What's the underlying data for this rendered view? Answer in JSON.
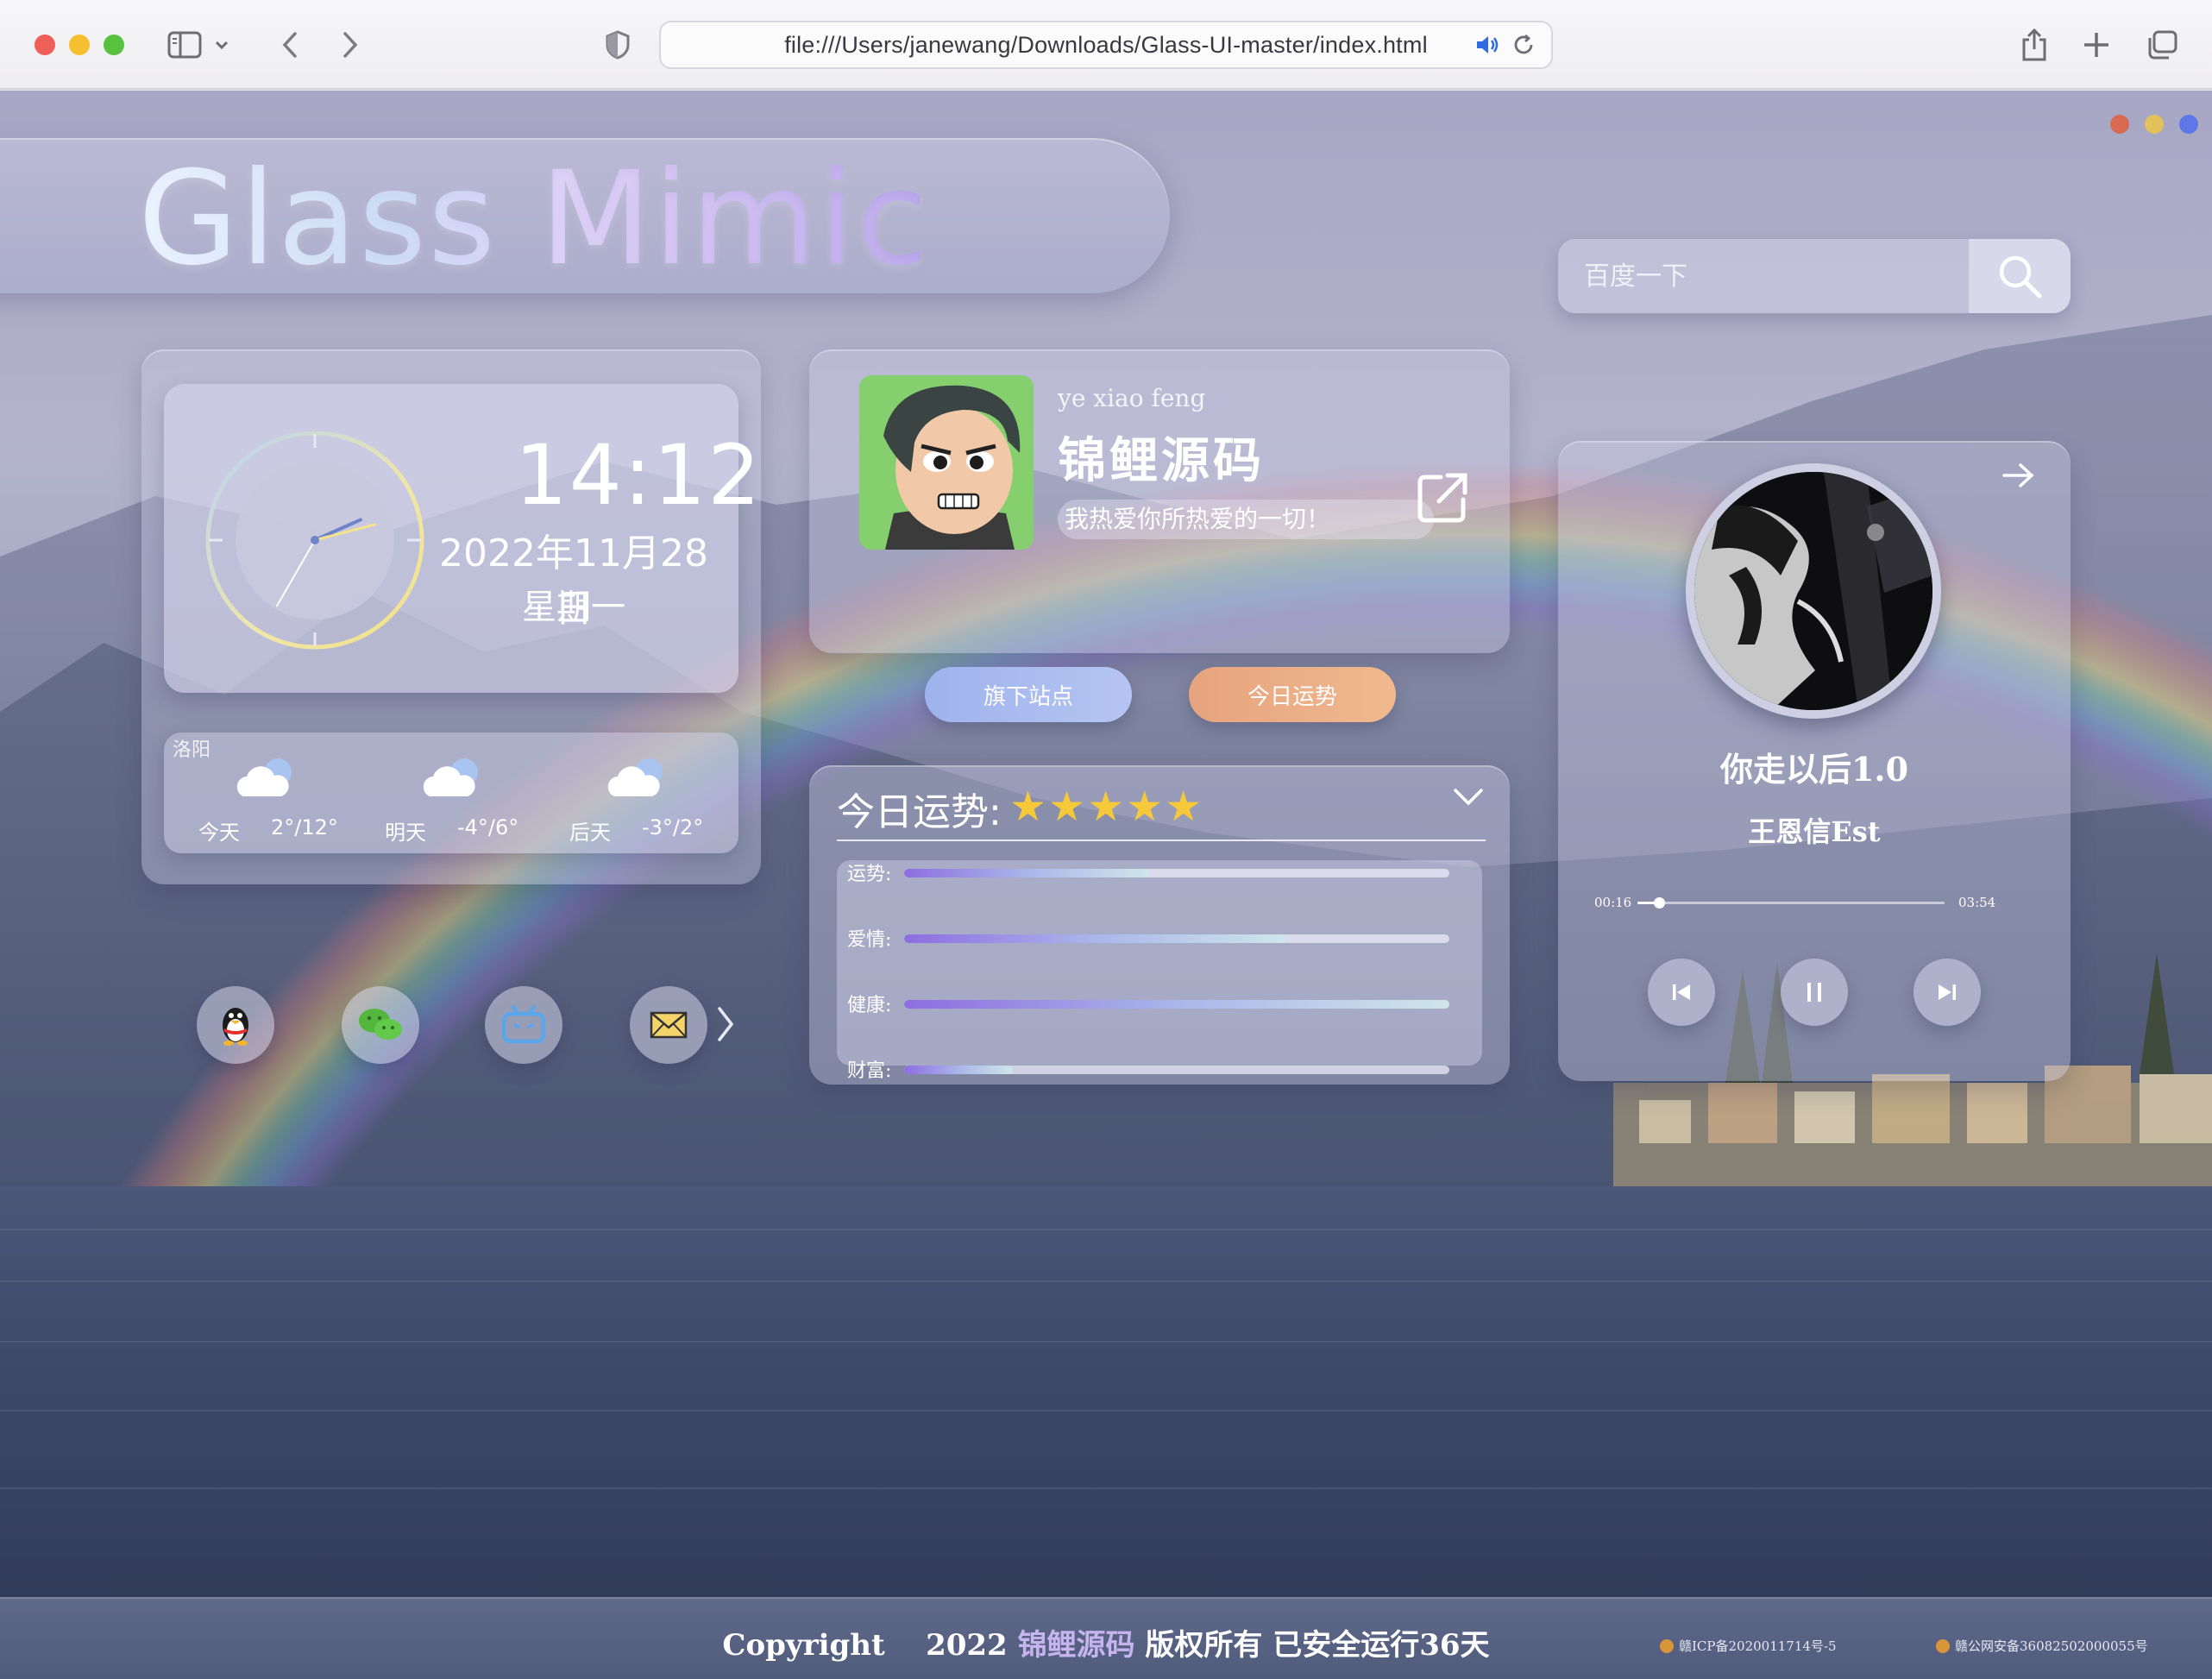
{
  "browser": {
    "url": "file:///Users/janewang/Downloads/Glass-UI-master/index.html"
  },
  "header": {
    "title": "Glass Mimic",
    "dots": [
      "#d86a52",
      "#e2c25b",
      "#5d78e6"
    ]
  },
  "search": {
    "placeholder": "百度一下",
    "icon": "search-icon"
  },
  "clock": {
    "time": "14:12",
    "date": "2022年11月28日",
    "weekday": "星期一",
    "hour": 14,
    "minute": 12,
    "second": 35
  },
  "weather": {
    "city": "洛阳",
    "days": [
      {
        "label": "今天",
        "temp": "2°/12°",
        "icon": "cloud-icon"
      },
      {
        "label": "明天",
        "temp": "-4°/6°",
        "icon": "cloud-icon"
      },
      {
        "label": "后天",
        "temp": "-3°/2°",
        "icon": "cloud-icon"
      }
    ]
  },
  "social": {
    "items": [
      {
        "name": "qq",
        "icon": "penguin-icon"
      },
      {
        "name": "wechat",
        "icon": "wechat-icon"
      },
      {
        "name": "bilibili",
        "icon": "tv-icon"
      },
      {
        "name": "email",
        "icon": "mail-icon"
      }
    ],
    "more_icon": "chevron-right-icon"
  },
  "profile": {
    "pinyin": "ye xiao feng",
    "name": "锦鲤源码",
    "motto": "我热爱你所热爱的一切！",
    "btn_sites": "旗下站点",
    "btn_fortune": "今日运势"
  },
  "fortune": {
    "title": "今日运势:",
    "stars": "★★★★★",
    "rows": [
      {
        "label": "运势:",
        "value": 0.45
      },
      {
        "label": "爱情:",
        "value": 0.7
      },
      {
        "label": "健康:",
        "value": 1.0
      },
      {
        "label": "财富:",
        "value": 0.2
      }
    ]
  },
  "music": {
    "song": "你走以后1.0",
    "artist": "王恩信Est",
    "current": "00:16",
    "total": "03:54",
    "progress": 0.07
  },
  "footer": {
    "copyright_prefix": "Copyright",
    "copyright_year": "2022",
    "brand": "锦鲤源码",
    "copyright_suffix": "版权所有 已安全运行36天",
    "icp": "赣ICP备2020011714号-5",
    "police": "赣公网安备36082502000055号"
  }
}
